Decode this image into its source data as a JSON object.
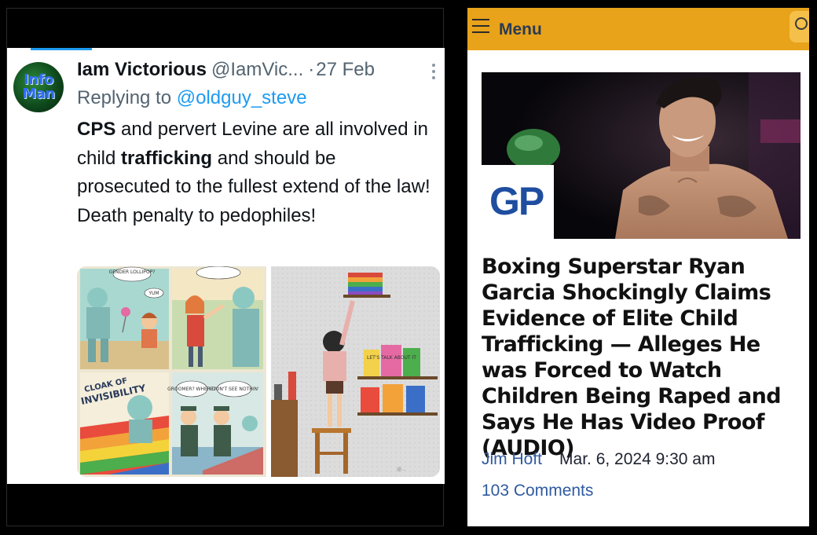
{
  "tweet": {
    "avatar_text": [
      "Info",
      "Man"
    ],
    "display_name": "Iam Victorious",
    "handle": "@IamVic...",
    "separator": "·",
    "date": "27 Feb",
    "reply_prefix": "Replying to",
    "reply_handle": "@oldguy_steve",
    "body": {
      "w1": "CPS",
      "t1": " and pervert Levine are all involved in child ",
      "w2": "trafficking",
      "t2": " and should be prosecuted to the fullest extend of the law! Death penalty to pedophiles!"
    },
    "comic_captions": {
      "gender_lollipop": "GENDER LOLLIPOP?",
      "yum": "YUM",
      "cloak": "CLOAK OF INVISIBILITY",
      "groomer": "GROOMER? WHERE?",
      "dont_see": "I DON'T SEE NOTHIN'",
      "book_talk": "LET'S TALK ABOUT IT"
    }
  },
  "article": {
    "menu_label": "Menu",
    "badge": "GP",
    "headline": "Boxing Superstar Ryan Garcia Shockingly Claims Evidence of Elite Child Trafficking — Alleges He was Forced to Watch Children Being Raped and Says He Has Video Proof (AUDIO)",
    "author": "Jim Hoft",
    "date": "Mar. 6, 2024 9:30 am",
    "comments": "103 Comments"
  },
  "colors": {
    "menubar": "#e8a31a",
    "link_blue": "#1d9bf0",
    "article_link": "#2f5aa0",
    "gp_blue": "#1f4ea0"
  },
  "icons": {
    "menu": "hamburger-icon",
    "search": "search-icon",
    "more": "more-dots-icon"
  }
}
